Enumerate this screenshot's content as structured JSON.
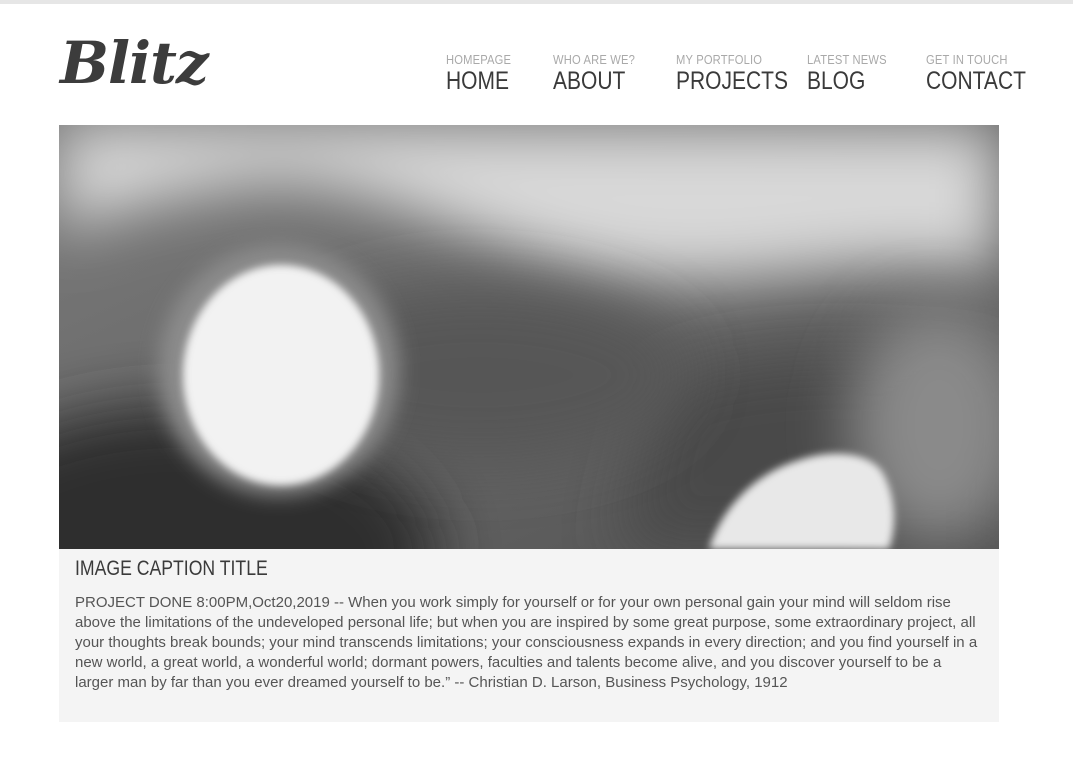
{
  "brand": {
    "logo_text": "Blitz"
  },
  "nav": {
    "items": [
      {
        "sub": "HOMEPAGE",
        "label": "HOME"
      },
      {
        "sub": "WHO ARE WE?",
        "label": "ABOUT"
      },
      {
        "sub": "MY PORTFOLIO",
        "label": "PROJECTS"
      },
      {
        "sub": "LATEST NEWS",
        "label": "BLOG"
      },
      {
        "sub": "GET IN TOUCH",
        "label": "CONTACT"
      }
    ]
  },
  "hero": {
    "image_icon": "blurred-grayscale-photo"
  },
  "caption": {
    "title": "IMAGE CAPTION TITLE",
    "text": "PROJECT DONE 8:00PM,Oct20,2019 -- When you work simply for yourself or for your own personal gain your mind will seldom rise above the limitations of the undeveloped personal life; but when you are inspired by some great purpose, some extraordinary project, all your thoughts break bounds; your mind transcends limitations; your consciousness expands in every direction; and you find yourself in a new world, a great world, a wonderful world; dormant powers, faculties and talents become alive, and you discover yourself to be a larger man by far than you ever dreamed yourself to be.” -- Christian D. Larson, Business Psychology, 1912"
  },
  "colors": {
    "text_dark": "#3a3a3a",
    "text_muted": "#a9a9a9",
    "caption_bg": "#f4f4f4",
    "body_text": "#555555"
  }
}
